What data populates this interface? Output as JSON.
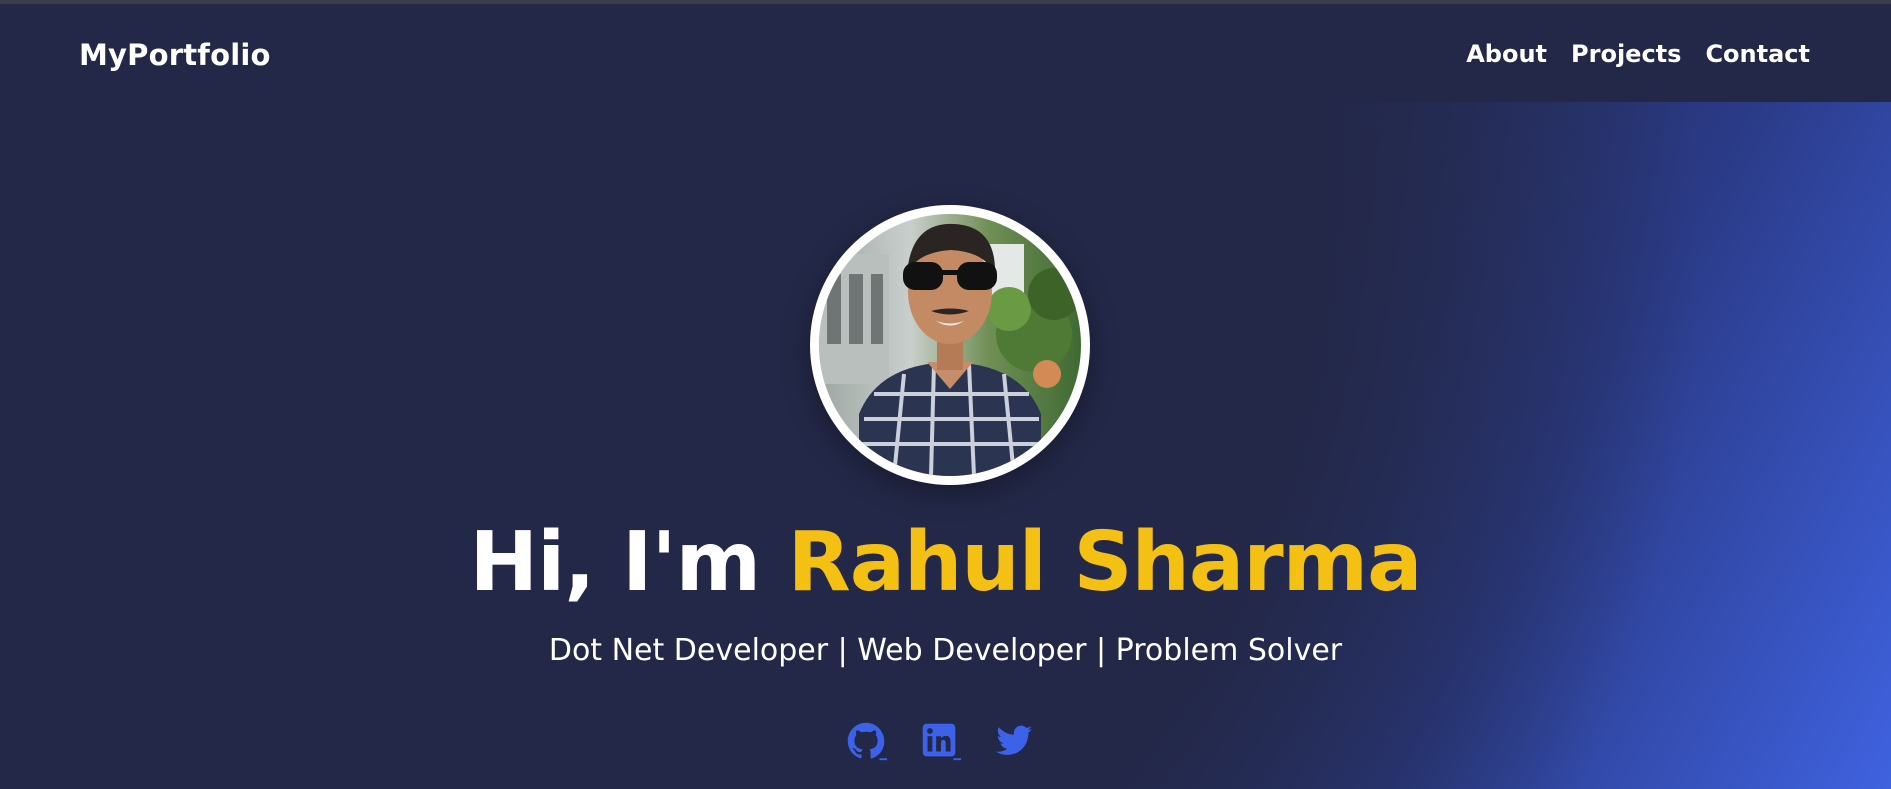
{
  "nav": {
    "brand": "MyPortfolio",
    "links": [
      "About",
      "Projects",
      "Contact"
    ]
  },
  "hero": {
    "greeting": "Hi, I'm ",
    "name": "Rahul Sharma",
    "subtitle": "Dot Net Developer | Web Developer | Problem Solver"
  },
  "socials": [
    {
      "icon": "github-icon"
    },
    {
      "icon": "linkedin-icon"
    },
    {
      "icon": "twitter-icon"
    }
  ],
  "colors": {
    "background": "#232848",
    "accent_gradient_end": "#3f62e0",
    "highlight": "#f5c014",
    "social_icon": "#3b62e8",
    "text": "#ffffff"
  }
}
